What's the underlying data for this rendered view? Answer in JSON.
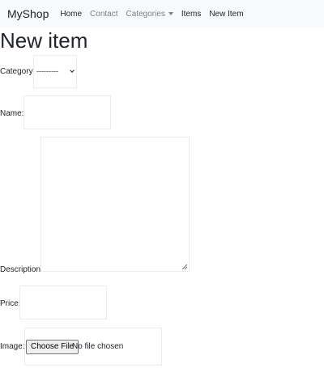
{
  "navbar": {
    "brand": "MyShop",
    "links": [
      {
        "label": "Home"
      },
      {
        "label": "Contact"
      },
      {
        "label": "Categories"
      },
      {
        "label": "Items"
      },
      {
        "label": "New Item"
      }
    ]
  },
  "page": {
    "title": "New item"
  },
  "form": {
    "category": {
      "label": "Category:",
      "selected": "---------"
    },
    "name": {
      "label": "Name:",
      "value": ""
    },
    "description": {
      "label": "Description:",
      "value": ""
    },
    "price": {
      "label": "Price:",
      "value": ""
    },
    "image": {
      "label": "Image:",
      "button": "Choose File",
      "status": "No file chosen"
    }
  },
  "colors": {
    "navbar_bg": "#f8f9fa",
    "muted_link": "#7b8086",
    "text": "#212529"
  }
}
